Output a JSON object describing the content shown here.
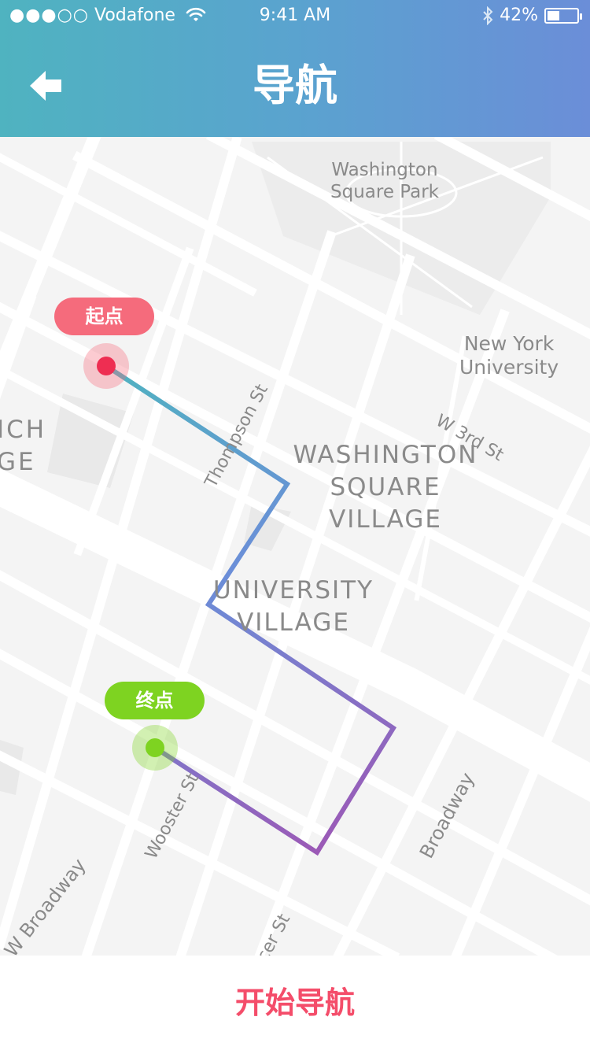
{
  "status_bar": {
    "carrier": "Vodafone",
    "signal_dots": "●●●○○",
    "time": "9:41 AM",
    "battery_percent": "42%",
    "battery_level": 0.42,
    "icons": [
      "wifi-icon",
      "bluetooth-icon",
      "battery-icon"
    ]
  },
  "header": {
    "title": "导航",
    "back_icon": "arrow-left-icon",
    "gradient": [
      "#4fb3c0",
      "#6b8ed8"
    ]
  },
  "map": {
    "labels": {
      "park": "Washington\nSquare Park",
      "nyu": "New York\nUniversity",
      "w3rd": "W 3rd St",
      "thompson": "Thompson St",
      "wsv": "WASHINGTON\nSQUARE\nVILLAGE",
      "univ": "UNIVERSITY\nVILLAGE",
      "ich": "ICH\nGE",
      "wooster": "Wooster St",
      "broadway": "Broadway",
      "wbroadway": "W Broadway",
      "mercer": "cer St"
    },
    "start": {
      "label": "起点",
      "color": "#f56b7c",
      "dot_color": "#ee2e52"
    },
    "end": {
      "label": "终点",
      "color": "#7ed321",
      "dot_color": "#7ed321"
    },
    "route_colors": [
      "#4fb3c0",
      "#6b8ed8",
      "#9b59b6"
    ]
  },
  "footer": {
    "button_label": "开始导航",
    "color": "#f44d6a"
  }
}
